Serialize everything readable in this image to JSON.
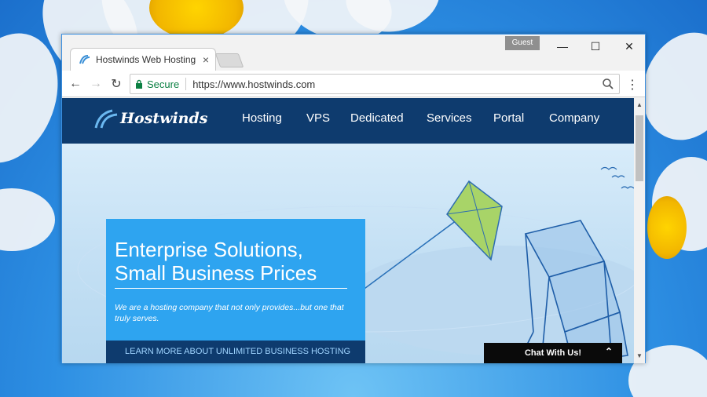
{
  "browser": {
    "tab_title": "Hostwinds Web Hosting",
    "tab_close": "×",
    "profile": "Guest",
    "controls": {
      "minimize": "—",
      "maximize": "☐",
      "close": "✕"
    },
    "nav": {
      "back": "←",
      "forward": "→",
      "reload": "↻",
      "menu": "⋮"
    },
    "security_label": "Secure",
    "url": "https://www.hostwinds.com"
  },
  "site": {
    "logo_text": "Hostwinds",
    "nav_items": [
      "Hosting",
      "VPS",
      "Dedicated",
      "Services",
      "Portal",
      "Company"
    ],
    "hero": {
      "title_line1": "Enterprise Solutions,",
      "title_line2": "Small Business Prices",
      "subtitle": "We are a hosting company that not only provides...but one that truly serves.",
      "cta": "LEARN MORE ABOUT UNLIMITED BUSINESS HOSTING"
    },
    "chat_label": "Chat With Us!",
    "chat_caret": "⌃"
  },
  "colors": {
    "nav_bg": "#0e3b6e",
    "hero_card": "#2ea4f0",
    "secure_green": "#0b8043",
    "kite_green": "#a8d468"
  },
  "icons": [
    "hostwinds-favicon-icon",
    "lock-icon",
    "zoom-icon",
    "kite-illustration",
    "box-kite-illustration",
    "bird-icon"
  ]
}
